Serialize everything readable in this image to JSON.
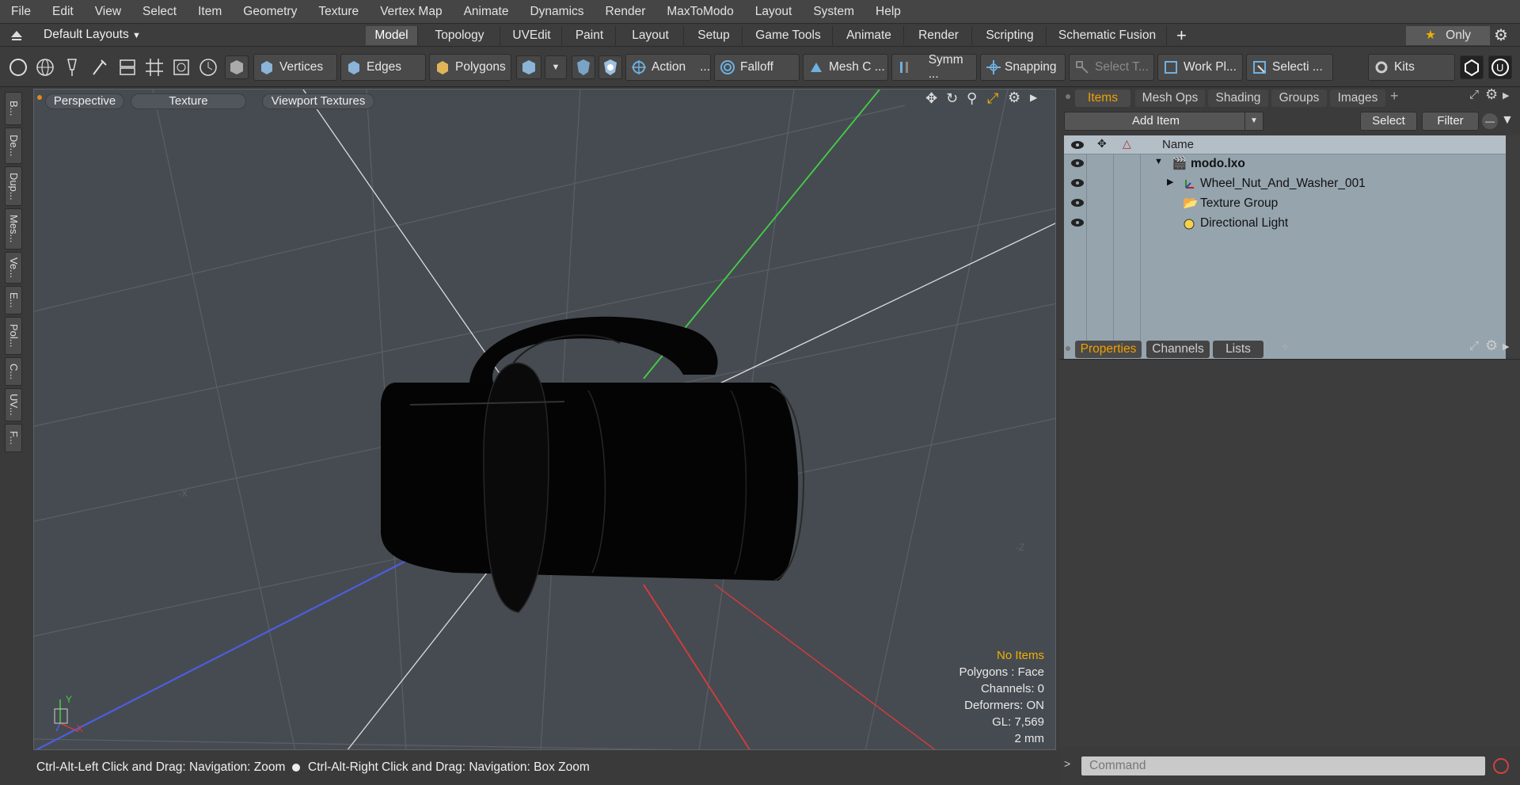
{
  "menu": [
    "File",
    "Edit",
    "View",
    "Select",
    "Item",
    "Geometry",
    "Texture",
    "Vertex Map",
    "Animate",
    "Dynamics",
    "Render",
    "MaxToModo",
    "Layout",
    "System",
    "Help"
  ],
  "layouts": {
    "current": "Default Layouts",
    "tabs": [
      "Model",
      "Topology",
      "UVEdit",
      "Paint",
      "Layout",
      "Setup",
      "Game Tools",
      "Animate",
      "Render",
      "Scripting",
      "Schematic Fusion"
    ],
    "active": "Model",
    "only_label": "Only"
  },
  "toolbar": {
    "vertices": "Vertices",
    "edges": "Edges",
    "polygons": "Polygons",
    "action": "Action",
    "falloff": "Falloff",
    "mesh_constraints": "Mesh C ...",
    "symmetry": "Symm ...",
    "snapping": "Snapping",
    "select_through": "Select T...",
    "work_plane": "Work Pl...",
    "selection_sets": "Selecti ...",
    "kits": "Kits"
  },
  "left_tabs": [
    "B...",
    "De...",
    "Dup...",
    "Mes...",
    "Ve...",
    "E...",
    "Pol...",
    "C...",
    "UV...",
    "F..."
  ],
  "viewport": {
    "view_mode": "Perspective",
    "shading": "Texture",
    "textures": "Viewport Textures",
    "stats": {
      "selection": "No Items",
      "polygons": "Polygons : Face",
      "channels": "Channels: 0",
      "deformers": "Deformers: ON",
      "gl": "GL: 7,569",
      "scale": "2 mm"
    },
    "axis_labels": {
      "x": "X",
      "y": "Y",
      "neg_x": "-X",
      "neg_z": "-Z"
    }
  },
  "status_bar": {
    "left": "Ctrl-Alt-Left Click and Drag: Navigation: Zoom",
    "right": "Ctrl-Alt-Right Click and Drag: Navigation: Box Zoom"
  },
  "items_panel": {
    "tabs": [
      "Items",
      "Mesh Ops",
      "Shading",
      "Groups",
      "Images"
    ],
    "active": "Items",
    "add_item": "Add Item",
    "select": "Select",
    "filter": "Filter",
    "name_header": "Name",
    "tree": [
      {
        "label": "modo.lxo",
        "bold": true
      },
      {
        "label": "Wheel_Nut_And_Washer_001"
      },
      {
        "label": "Texture Group"
      },
      {
        "label": "Directional Light"
      }
    ]
  },
  "properties_panel": {
    "tabs": [
      "Properties",
      "Channels",
      "Lists"
    ],
    "active": "Properties"
  },
  "command": {
    "placeholder": "Command"
  },
  "colors": {
    "accent": "#f0a000",
    "x_axis": "#d93b3b",
    "y_axis": "#44d044",
    "z_axis": "#4d5de0"
  }
}
